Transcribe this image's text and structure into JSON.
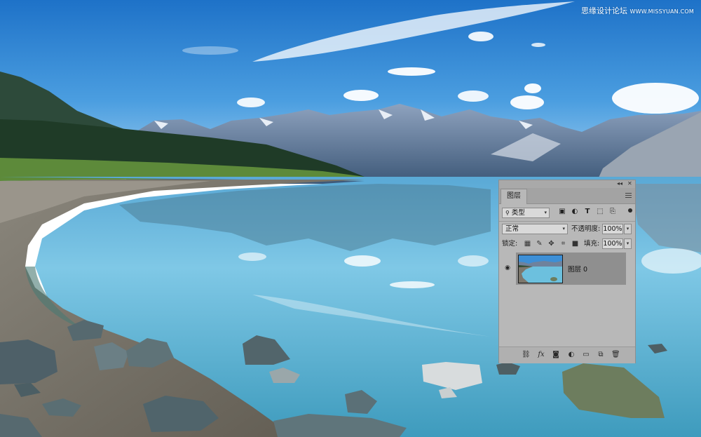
{
  "watermark": {
    "cn": "思缘设计论坛",
    "url": "WWW.MISSYUAN.COM"
  },
  "panel": {
    "title_controls": {
      "collapse": "◂◂",
      "close": "✕"
    },
    "tab_label": "图层",
    "filter": {
      "label": "类型",
      "icons": [
        "image-filter-icon",
        "adjustment-filter-icon",
        "type-filter-icon",
        "shape-filter-icon",
        "smart-object-filter-icon"
      ]
    },
    "blend_mode": "正常",
    "opacity": {
      "label": "不透明度:",
      "value": "100%"
    },
    "lock": {
      "label": "锁定:",
      "icons": [
        "lock-transparent-pixels-icon",
        "lock-image-pixels-icon",
        "lock-position-icon",
        "lock-artboard-icon",
        "lock-all-icon"
      ]
    },
    "fill": {
      "label": "填充:",
      "value": "100%"
    },
    "layers": [
      {
        "name": "图层 0",
        "visible": true
      }
    ],
    "footer_icons": [
      "link-layers-icon",
      "fx-icon",
      "add-mask-icon",
      "new-adjustment-layer-icon",
      "new-group-icon",
      "new-layer-icon",
      "delete-layer-icon"
    ],
    "fx_text": "fx"
  },
  "colors": {
    "sky": "#3d8fd6",
    "water": "#6fc2e0",
    "panel_bg": "#b8b8b8",
    "selected_row": "#8f8f8f"
  }
}
